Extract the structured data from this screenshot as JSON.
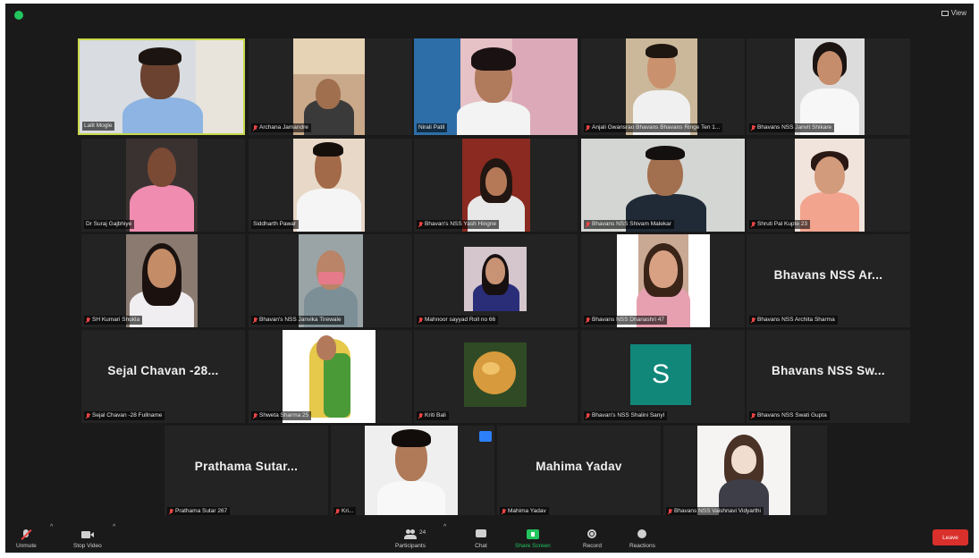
{
  "window": {
    "view_label": "View"
  },
  "participants": [
    {
      "name": "Lalit Mogle",
      "active": true
    },
    {
      "name": "Archana Jamandre"
    },
    {
      "name": "Nirali Patil"
    },
    {
      "name": "Anjali Gwansrao Bhavans Bhavans Ringe Ten 1..."
    },
    {
      "name": "Bhavans NSS Janvit Shikare"
    },
    {
      "name": "Dr Suraj Gajbhiye"
    },
    {
      "name": "Siddharth Pawar"
    },
    {
      "name": "Bhavan's NSS Yash Hingne"
    },
    {
      "name": "Bhavans NSS Shivam Malekar"
    },
    {
      "name": "Shruti Pal Kupte 23"
    },
    {
      "name": "SH Kumari Shukla"
    },
    {
      "name": "Bhavan's NSS Janvika Tirewale"
    },
    {
      "name": "Mahnoor sayyad Roll no 66"
    },
    {
      "name": "Bhavans NSS Dhanashri 47"
    },
    {
      "name": "Bhavans NSS Archita Sharma",
      "card": "Bhavans NSS Ar..."
    },
    {
      "name": "Sejal Chavan -28 Fullname",
      "card": "Sejal Chavan -28..."
    },
    {
      "name": "Shweta Sharma 25"
    },
    {
      "name": "Kriti Bali"
    },
    {
      "name": "Bhavan's NSS Shalini Sanyl",
      "avatar": "S"
    },
    {
      "name": "Bhavans NSS Swati Gupta",
      "card": "Bhavans NSS Sw..."
    },
    {
      "name": "Prathama Sutar 267",
      "card": "Prathama Sutar..."
    },
    {
      "name": "Kri..."
    },
    {
      "name": "Mahima Yadav",
      "card": "Mahima Yadav"
    },
    {
      "name": "Bhavans NSS Vaishnavi Vidyarthi"
    }
  ],
  "toolbar": {
    "unmute": "Unmute",
    "stop_video": "Stop Video",
    "participants": "Participants",
    "participants_count": "24",
    "chat": "Chat",
    "share_screen": "Share Screen",
    "record": "Record",
    "reactions": "Reactions",
    "leave": "Leave"
  },
  "colors": {
    "active_border": "#c8d94a",
    "share_green": "#22c55e",
    "leave_red": "#d9302c",
    "avatar_teal": "#11877a"
  }
}
